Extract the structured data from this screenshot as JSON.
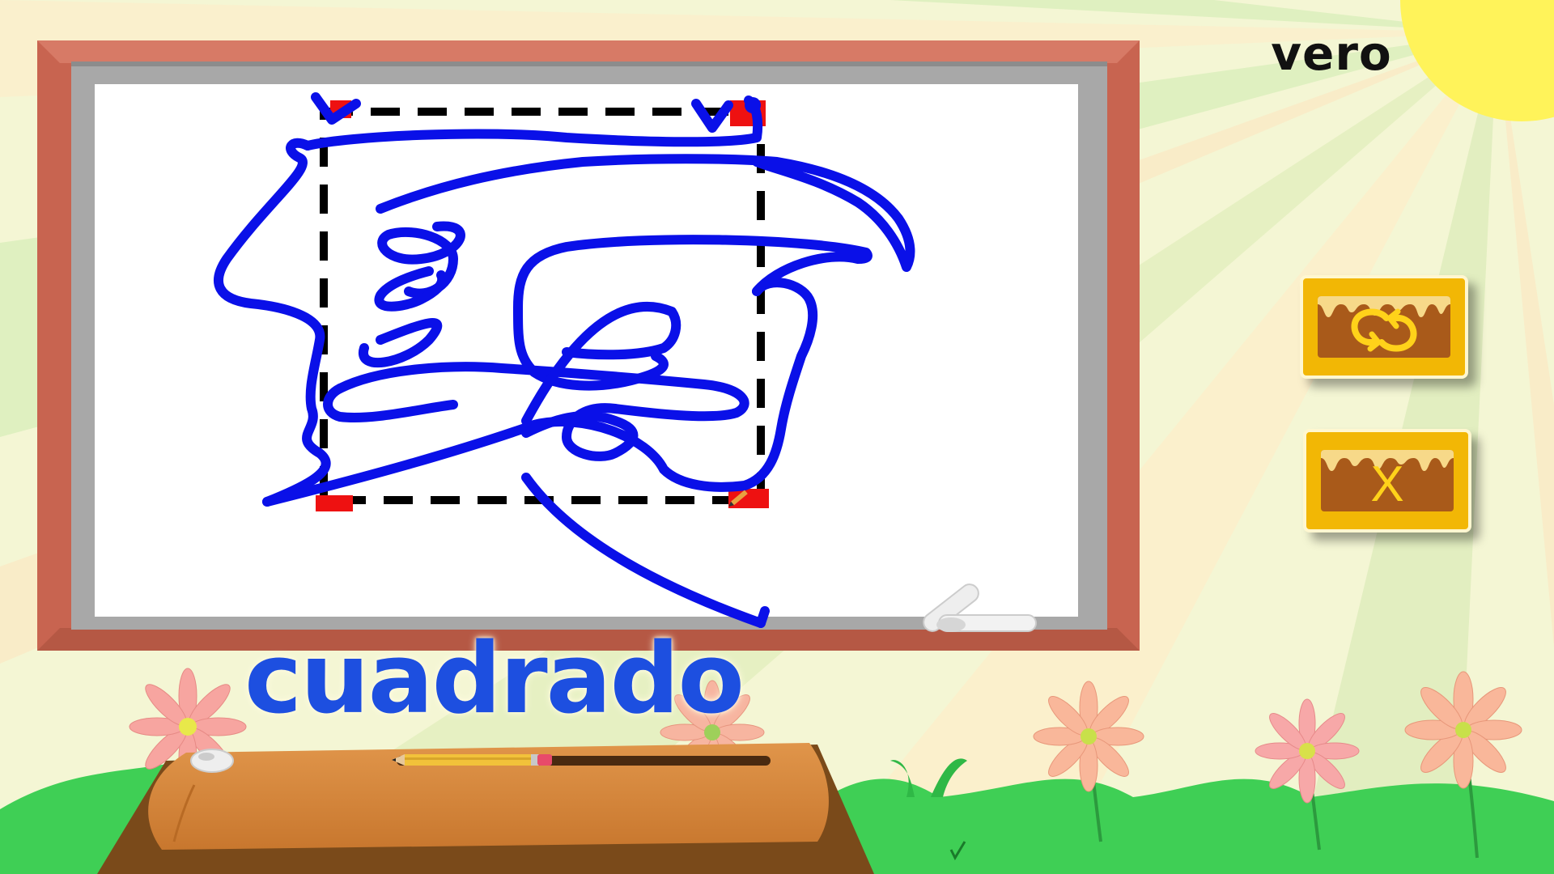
{
  "player": {
    "name": "vero"
  },
  "word": {
    "text": "cuadrado"
  },
  "controls": {
    "reset_icon": "swap-arrows-icon",
    "close_label": "X"
  },
  "colors": {
    "stroke": "#0a10e8",
    "frame": "#c86450",
    "board": "#ffffff",
    "button": "#f2b705",
    "button_inner": "#a95a1a",
    "word": "#1d4fe0",
    "grass": "#3fcf55"
  }
}
